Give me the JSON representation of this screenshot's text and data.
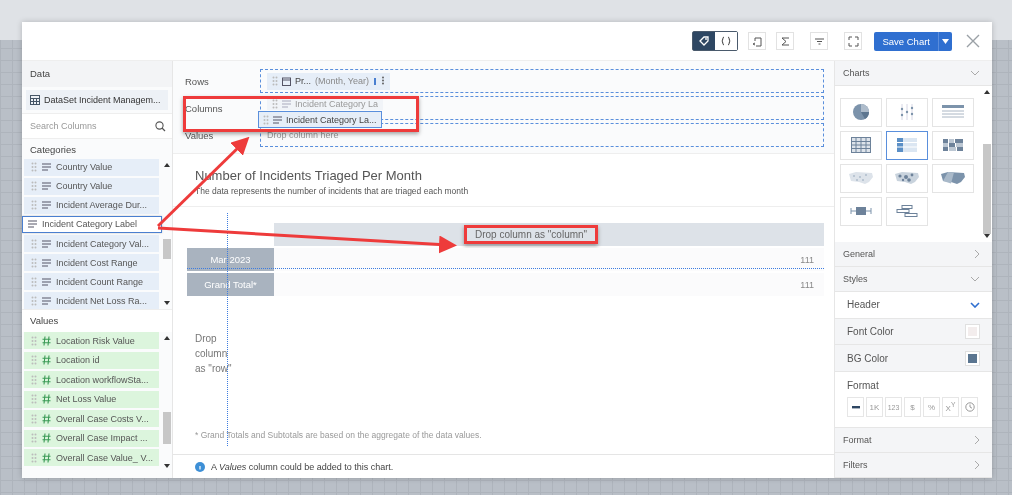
{
  "toolbar": {
    "toggle": [
      {
        "kind": "tag",
        "selected": true
      },
      {
        "kind": "braces",
        "selected": false
      }
    ],
    "save_button": "Save Chart"
  },
  "data_panel": {
    "title": "Data",
    "dataset": "DataSet Incident Managem...",
    "search_placeholder": "Search Columns",
    "categories_label": "Categories",
    "categories": [
      {
        "label": "Country Value",
        "selected": false
      },
      {
        "label": "Country Value",
        "selected": false
      },
      {
        "label": "Incident Average Dur...",
        "selected": false
      },
      {
        "label": "Incident Category Label",
        "selected": true
      },
      {
        "label": "Incident Category Val...",
        "selected": false
      },
      {
        "label": "Incident Cost Range",
        "selected": false
      },
      {
        "label": "Incident Count Range",
        "selected": false
      },
      {
        "label": "Incident Net Loss Ra...",
        "selected": false
      }
    ],
    "values_label": "Values",
    "values": [
      "Location Risk Value",
      "Location id",
      "Location workflowSta...",
      "Net Loss Value",
      "Overall Case Costs V...",
      "Overall Case Impact ...",
      "Overall Case Value_ V..."
    ]
  },
  "shelves": [
    {
      "label": "Rows",
      "chip": "Pr...",
      "detail": "(Month, Year)"
    },
    {
      "label": "Columns",
      "chip": "Incident Category La"
    },
    {
      "label": "Values",
      "placeholder": "Drop column here"
    }
  ],
  "drag_chip": "Incident Category La...",
  "chart": {
    "title": "Number of Incidents Triaged Per Month",
    "subtitle": "The data represents the number of incidents that are triaged each month",
    "column_drop": "Drop column as \"column\"",
    "rows": [
      {
        "label": "Mar 2023",
        "value": "111"
      },
      {
        "label": "Grand Total*",
        "value": "111"
      }
    ],
    "row_drop": "Drop column as \"row\"",
    "footnote": "* Grand Totals and Subtotals are based on the aggregate of the data values."
  },
  "info": "A *Values* column could be added to this chart.",
  "charts_panel": {
    "title": "Charts",
    "types": [
      {
        "kind": "pie",
        "selected": false
      },
      {
        "kind": "dots",
        "selected": false
      },
      {
        "kind": "lines-table",
        "selected": false
      },
      {
        "kind": "grid-table",
        "selected": false
      },
      {
        "kind": "heat-table",
        "selected": true
      },
      {
        "kind": "blocks",
        "selected": false
      },
      {
        "kind": "map-dots",
        "selected": false
      },
      {
        "kind": "map-bubbles",
        "selected": false
      },
      {
        "kind": "map-filled",
        "selected": false
      },
      {
        "kind": "boxplot",
        "selected": false
      },
      {
        "kind": "gantt",
        "selected": false
      }
    ]
  },
  "general": "General",
  "styles": "Styles",
  "header": "Header",
  "style_items": [
    {
      "label": "Font Color",
      "color": "#f3eded"
    },
    {
      "label": "BG Color",
      "color": "#5a7590"
    }
  ],
  "format": {
    "label": "Format",
    "buttons": [
      {
        "kind": "minus",
        "selected": true
      },
      {
        "kind": "text",
        "text": "1K",
        "selected": false
      },
      {
        "kind": "small",
        "text": "123",
        "selected": false
      },
      {
        "kind": "text",
        "text": "$",
        "selected": false
      },
      {
        "kind": "text",
        "text": "%",
        "selected": false
      },
      {
        "kind": "text",
        "text": "X$^{Y}$",
        "selected": false
      },
      {
        "kind": "clock",
        "selected": false
      }
    ]
  },
  "sections_bottom": [
    "Format",
    "Filters"
  ]
}
